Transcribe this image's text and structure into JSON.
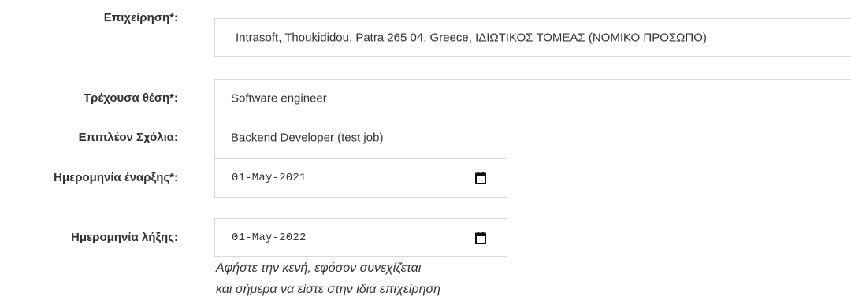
{
  "form": {
    "company": {
      "label": "Επιχείρηση*:",
      "value": "Intrasoft, Thoukididou, Patra 265 04, Greece, ΙΔΙΩΤΙΚΟΣ ΤΟΜΕΑΣ (ΝΟΜΙΚΟ ΠΡΟΣΩΠΟ)"
    },
    "position": {
      "label": "Τρέχουσα θέση*:",
      "value": "Software engineer"
    },
    "comments": {
      "label": "Επιπλέον Σχόλια:",
      "value": "Backend Developer (test job)"
    },
    "start_date": {
      "label": "Ημερομηνία έναρξης*:",
      "value": "01-May-2021",
      "icon": "calendar-icon"
    },
    "end_date": {
      "label": "Ημερομηνία λήξης:",
      "value": "01-May-2022",
      "icon": "calendar-icon",
      "help_line1": "Αφήστε την κενή, εφόσον συνεχίζεται",
      "help_line2": "και σήμερα να είστε στην ίδια επιχείρηση"
    }
  }
}
